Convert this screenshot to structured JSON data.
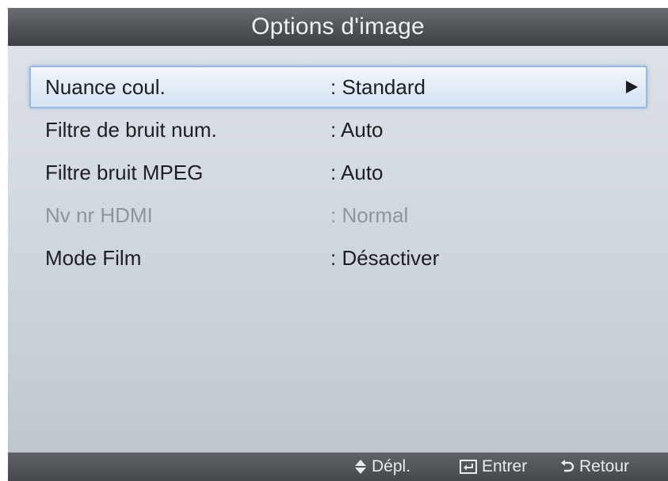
{
  "title": "Options d'image",
  "menu": {
    "items": [
      {
        "label": "Nuance coul.",
        "value": ": Standard"
      },
      {
        "label": "Filtre de bruit num.",
        "value": ": Auto"
      },
      {
        "label": "Filtre bruit MPEG",
        "value": ": Auto"
      },
      {
        "label": "Nv nr HDMI",
        "value": ": Normal"
      },
      {
        "label": "Mode Film",
        "value": ": Désactiver"
      }
    ]
  },
  "footer": {
    "move": {
      "icon": "up-down-arrow-icon",
      "label": "Dépl."
    },
    "enter": {
      "icon": "enter-icon",
      "label": "Entrer"
    },
    "return": {
      "icon": "return-icon",
      "label": "Retour"
    }
  },
  "colors": {
    "title_bar": "#4f5358",
    "selection_border": "#9bb8dd",
    "disabled_text": "#8e959c"
  }
}
